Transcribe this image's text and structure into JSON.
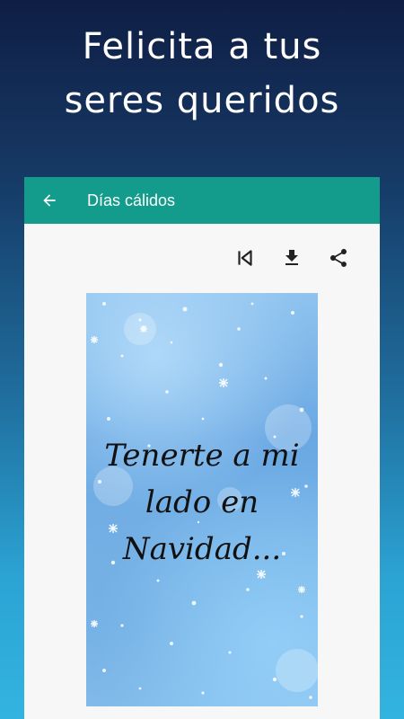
{
  "headline": {
    "line1": "Felicita a tus",
    "line2": "seres queridos"
  },
  "app": {
    "title": "Días cálidos",
    "accent_color": "#139c8b",
    "icons": {
      "back": "arrow-left-icon",
      "first": "skip-previous-icon",
      "download": "download-icon",
      "share": "share-icon"
    }
  },
  "card": {
    "line1": "Tenerte a mi",
    "line2": "lado en",
    "line3": "Navidad..."
  }
}
